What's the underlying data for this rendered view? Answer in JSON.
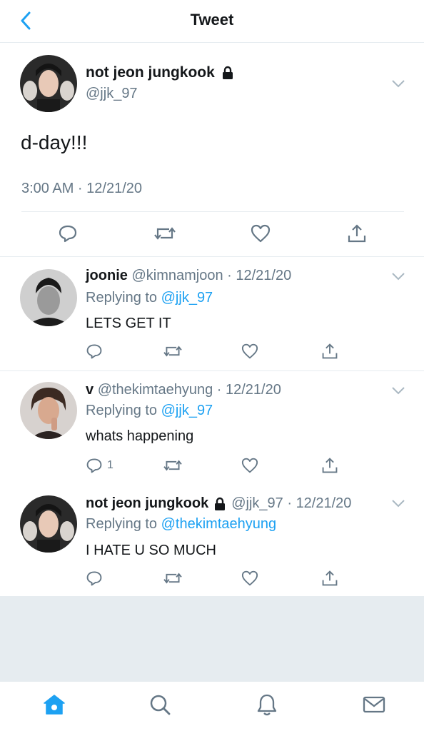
{
  "header": {
    "title": "Tweet"
  },
  "main_tweet": {
    "name": "not jeon jungkook",
    "handle": "@jjk_97",
    "text": "d-day!!!",
    "timestamp": "3:00 AM · 12/21/20"
  },
  "replies": [
    {
      "name": "joonie",
      "handle": "@kimnamjoon",
      "date": "12/21/20",
      "replying_prefix": "Replying to",
      "replying_to": "@jjk_97",
      "text": "LETS GET IT",
      "reply_count": ""
    },
    {
      "name": "v",
      "handle": "@thekimtaehyung",
      "date": "12/21/20",
      "replying_prefix": "Replying to",
      "replying_to": "@jjk_97",
      "text": "whats happening",
      "reply_count": "1"
    },
    {
      "name": "not jeon jungkook",
      "handle": "@jjk_97",
      "date": "12/21/20",
      "replying_prefix": "Replying to",
      "replying_to": "@thekimtaehyung",
      "text": "I HATE U SO MUCH",
      "reply_count": ""
    }
  ],
  "colors": {
    "accent": "#1da1f2",
    "secondary_text": "#657786",
    "divider": "#e6ecf0"
  },
  "icons": {
    "back": "chevron-left-icon",
    "lock": "lock-icon",
    "reply": "reply-icon",
    "retweet": "retweet-icon",
    "like": "heart-icon",
    "share": "share-icon",
    "home": "home-icon",
    "search": "search-icon",
    "notifications": "bell-icon",
    "messages": "mail-icon"
  }
}
